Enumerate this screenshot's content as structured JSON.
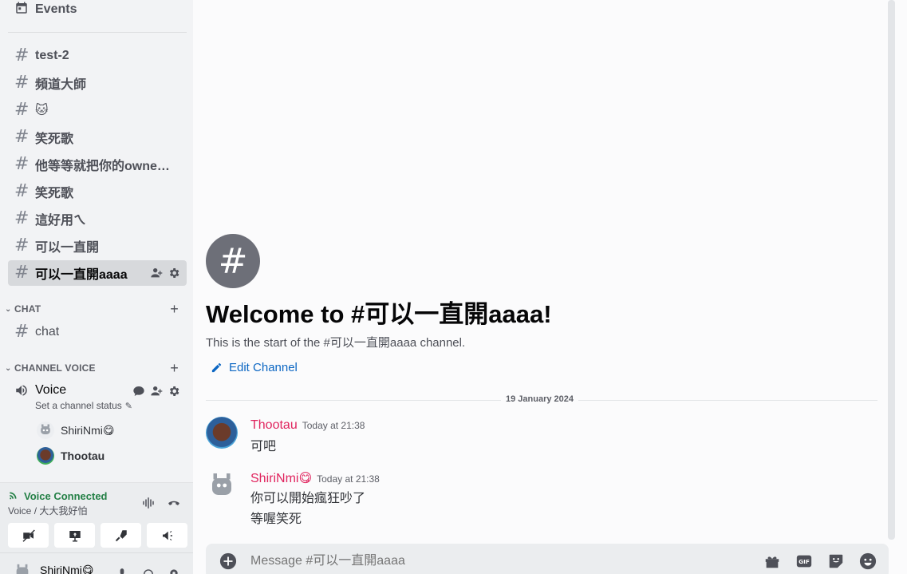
{
  "sidebar": {
    "events_label": "Events",
    "channels": [
      {
        "name": "test-2"
      },
      {
        "name": "頻道大師"
      },
      {
        "name": "🐱"
      },
      {
        "name": "笑死歌"
      },
      {
        "name": "他等等就把你的owner..."
      },
      {
        "name": "笑死歌"
      },
      {
        "name": "這好用ㄟ"
      },
      {
        "name": "可以一直開"
      },
      {
        "name": "可以一直開aaaa"
      }
    ],
    "category_chat": "CHAT",
    "chat_channel": "chat",
    "category_voice": "CHANNEL VOICE",
    "voice_channel": "Voice",
    "voice_status": "Set a channel status",
    "voice_users": [
      {
        "name": "ShiriNmi😋"
      },
      {
        "name": "Thootau"
      }
    ]
  },
  "voice_panel": {
    "status": "Voice Connected",
    "location": "Voice / 大大我好怕"
  },
  "user_panel": {
    "username": "ShiriNmi😋"
  },
  "main": {
    "welcome_title": "Welcome to #可以一直開aaaa!",
    "welcome_sub": "This is the start of the #可以一直開aaaa channel.",
    "edit_channel": "Edit Channel",
    "date_divider": "19 January 2024",
    "messages": [
      {
        "author": "Thootau",
        "time": "Today at 21:38",
        "lines": [
          "可吧"
        ]
      },
      {
        "author": "ShiriNmi😋",
        "time": "Today at 21:38",
        "lines": [
          "你可以開始瘋狂吵了",
          "等喔笑死"
        ]
      }
    ],
    "composer_placeholder": "Message #可以一直開aaaa"
  },
  "colors": {
    "accent_link": "#0b66c3",
    "author_color": "#e0245e",
    "voice_connected": "#248046"
  }
}
